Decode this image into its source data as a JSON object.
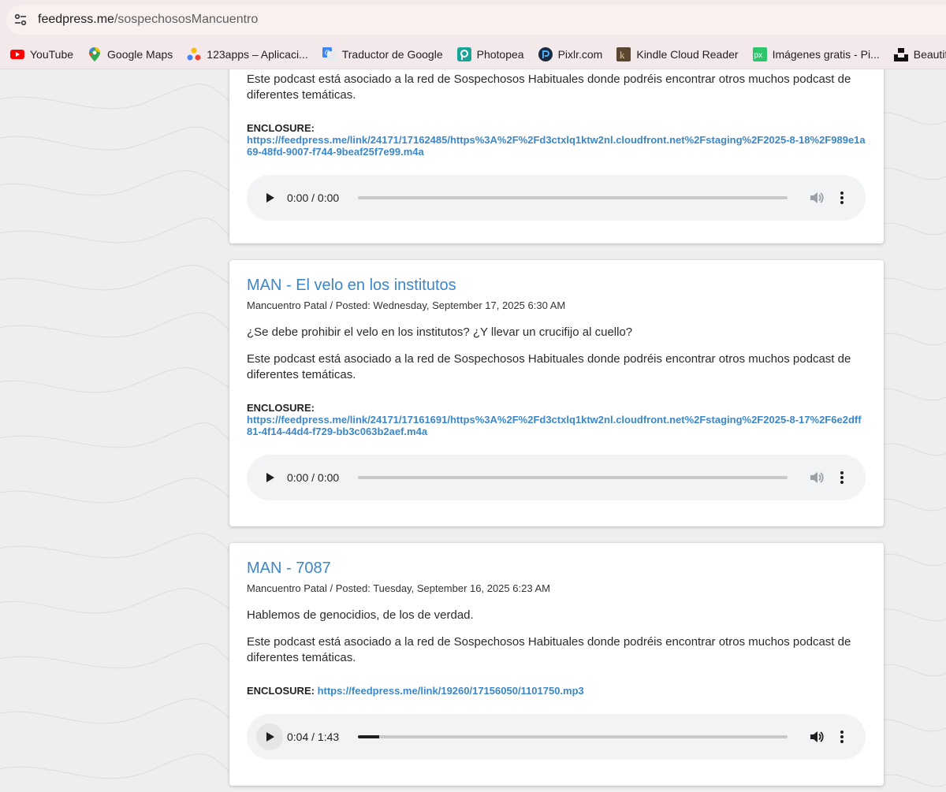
{
  "browser": {
    "url_host": "feedpress.me",
    "url_path": "/sospechososMancuentro",
    "bookmarks": [
      {
        "label": "YouTube",
        "icon": "youtube-icon"
      },
      {
        "label": "Google Maps",
        "icon": "google-maps-icon"
      },
      {
        "label": "123apps – Aplicaci...",
        "icon": "123apps-icon"
      },
      {
        "label": "Traductor de Google",
        "icon": "google-translate-icon"
      },
      {
        "label": "Photopea",
        "icon": "photopea-icon"
      },
      {
        "label": "Pixlr.com",
        "icon": "pixlr-icon"
      },
      {
        "label": "Kindle Cloud Reader",
        "icon": "kindle-icon"
      },
      {
        "label": "Imágenes gratis - Pi...",
        "icon": "pixabay-icon"
      },
      {
        "label": "Beautiful Free Imag",
        "icon": "unsplash-icon"
      }
    ]
  },
  "episodes": [
    {
      "title": "",
      "meta": "",
      "summary": "",
      "network_note": "Este podcast está asociado a la red de Sospechosos Habituales donde podréis encontrar otros muchos podcast de diferentes temáticas.",
      "enclosure_label": "ENCLOSURE:",
      "enclosure_url": "https://feedpress.me/link/24171/17162485/https%3A%2F%2Fd3ctxlq1ktw2nl.cloudfront.net%2Fstaging%2F2025-8-18%2F989e1a69-48fd-9007-f744-9beaf25f7e99.m4a",
      "time": "0:00 / 0:00",
      "progress": 0
    },
    {
      "title": "MAN - El velo en los institutos",
      "meta": "Mancuentro Patal / Posted: Wednesday, September 17, 2025 6:30 AM",
      "summary": "¿Se debe prohibir el velo en los institutos? ¿Y llevar un crucifijo al cuello?",
      "network_note": "Este podcast está asociado a la red de Sospechosos Habituales donde podréis encontrar otros muchos podcast de diferentes temáticas.",
      "enclosure_label": "ENCLOSURE:",
      "enclosure_url": "https://feedpress.me/link/24171/17161691/https%3A%2F%2Fd3ctxlq1ktw2nl.cloudfront.net%2Fstaging%2F2025-8-17%2F6e2dff81-4f14-44d4-f729-bb3c063b2aef.m4a",
      "time": "0:00 / 0:00",
      "progress": 0
    },
    {
      "title": "MAN - 7087",
      "meta": "Mancuentro Patal / Posted: Tuesday, September 16, 2025 6:23 AM",
      "summary": "Hablemos de genocidios, de los de verdad.",
      "network_note": "Este podcast está asociado a la red de Sospechosos Habituales donde podréis encontrar otros muchos podcast de diferentes temáticas.",
      "enclosure_label": "ENCLOSURE:",
      "enclosure_url": "https://feedpress.me/link/19260/17156050/1101750.mp3",
      "time": "0:04 / 1:43",
      "progress": 0.05
    }
  ],
  "colors": {
    "link": "#3b87c9",
    "chrome_bg": "#f4e9ea"
  }
}
